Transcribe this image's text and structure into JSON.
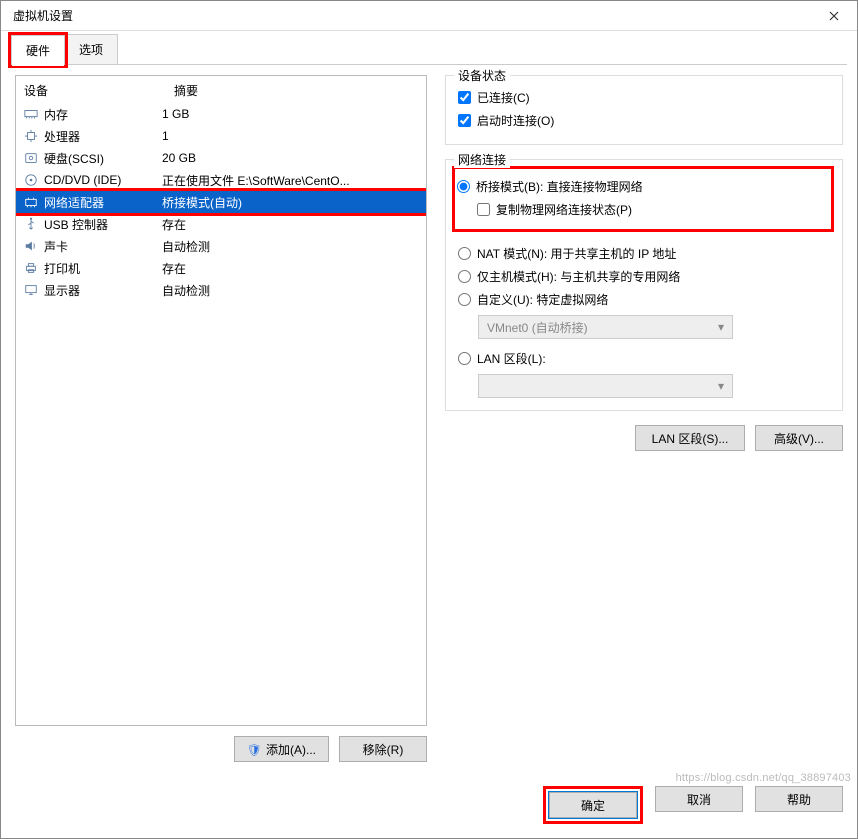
{
  "window": {
    "title": "虚拟机设置"
  },
  "tabs": {
    "hardware": "硬件",
    "options": "选项"
  },
  "deviceTable": {
    "headers": {
      "device": "设备",
      "summary": "摘要"
    },
    "rows": [
      {
        "icon": "memory-icon",
        "name": "内存",
        "summary": "1 GB"
      },
      {
        "icon": "cpu-icon",
        "name": "处理器",
        "summary": "1"
      },
      {
        "icon": "disk-icon",
        "name": "硬盘(SCSI)",
        "summary": "20 GB"
      },
      {
        "icon": "cd-icon",
        "name": "CD/DVD (IDE)",
        "summary": "正在使用文件  E:\\SoftWare\\CentO..."
      },
      {
        "icon": "nic-icon",
        "name": "网络适配器",
        "summary": "桥接模式(自动)",
        "selected": true
      },
      {
        "icon": "usb-icon",
        "name": "USB 控制器",
        "summary": "存在"
      },
      {
        "icon": "sound-icon",
        "name": "声卡",
        "summary": "自动检测"
      },
      {
        "icon": "printer-icon",
        "name": "打印机",
        "summary": "存在"
      },
      {
        "icon": "display-icon",
        "name": "显示器",
        "summary": "自动检测"
      }
    ],
    "buttons": {
      "add": "添加(A)...",
      "remove": "移除(R)"
    }
  },
  "deviceStatus": {
    "legend": "设备状态",
    "connected": "已连接(C)",
    "connectAtPowerOn": "启动时连接(O)"
  },
  "network": {
    "legend": "网络连接",
    "bridged": "桥接模式(B): 直接连接物理网络",
    "replicate": "复制物理网络连接状态(P)",
    "nat": "NAT 模式(N): 用于共享主机的 IP 地址",
    "hostonly": "仅主机模式(H): 与主机共享的专用网络",
    "custom": "自定义(U): 特定虚拟网络",
    "customValue": "VMnet0 (自动桥接)",
    "lan": "LAN 区段(L):",
    "lanValue": "",
    "btnLan": "LAN 区段(S)...",
    "btnAdv": "高级(V)..."
  },
  "footer": {
    "ok": "确定",
    "cancel": "取消",
    "help": "帮助"
  }
}
